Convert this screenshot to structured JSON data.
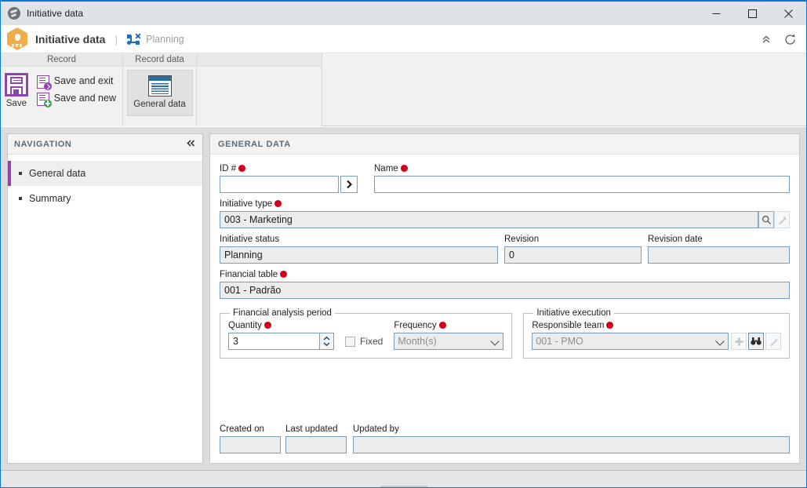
{
  "window": {
    "title": "Initiative data",
    "icon": "globe-icon",
    "minimize_label": "Minimize",
    "maximize_label": "Maximize",
    "close_label": "Close"
  },
  "header": {
    "app_title": "Initiative data",
    "separator": "|",
    "context_label": "Planning",
    "context_icon": "workflow-icon",
    "collapse_icon": "chevron-double-up-icon",
    "refresh_icon": "refresh-icon",
    "accent_hex": "#f0ad4e"
  },
  "ribbon": {
    "groups": [
      {
        "title": "Record"
      },
      {
        "title": "Record data"
      },
      {
        "title": ""
      }
    ],
    "save_label": "Save",
    "save_and_exit_label": "Save and exit",
    "save_and_new_label": "Save and new",
    "general_data_label": "General data",
    "save_icon": "floppy-disk-icon",
    "save_exit_icon": "document-arrow-icon",
    "save_new_icon": "document-plus-icon",
    "general_data_icon": "document-lines-icon",
    "accent_hex": "#8e44ad"
  },
  "navigation": {
    "title": "NAVIGATION",
    "collapse_icon": "chevron-double-left-icon",
    "items": [
      {
        "label": "General data",
        "active": true
      },
      {
        "label": "Summary",
        "active": false
      }
    ],
    "active_marker_hex": "#8e44ad"
  },
  "panel": {
    "title": "GENERAL DATA"
  },
  "form": {
    "required_marker": "required-asterisk-icon",
    "id": {
      "label": "ID #",
      "required": true,
      "value": "",
      "go_icon": "chevron-right-icon"
    },
    "name": {
      "label": "Name",
      "required": true,
      "value": ""
    },
    "initiative_type": {
      "label": "Initiative type",
      "required": true,
      "value": "003 - Marketing",
      "search_icon": "magnifier-icon",
      "clear_icon": "eraser-icon"
    },
    "initiative_status": {
      "label": "Initiative status",
      "required": false,
      "value": "Planning"
    },
    "revision": {
      "label": "Revision",
      "required": false,
      "value": "0"
    },
    "revision_date": {
      "label": "Revision date",
      "required": false,
      "value": ""
    },
    "financial_table": {
      "label": "Financial table",
      "required": true,
      "value": "001 - Padrão"
    },
    "financial_analysis_period": {
      "legend": "Financial analysis period",
      "quantity": {
        "label": "Quantity",
        "required": true,
        "value": "3",
        "spinner_icon": "spinner-up-down-icon"
      },
      "fixed": {
        "label": "Fixed",
        "checked": false
      },
      "frequency": {
        "label": "Frequency",
        "required": true,
        "value": "Month(s)",
        "options": [
          "Month(s)"
        ],
        "dropdown_icon": "chevron-down-icon"
      }
    },
    "initiative_execution": {
      "legend": "Initiative execution",
      "responsible_team": {
        "label": "Responsible team",
        "required": true,
        "value": "001 - PMO",
        "options": [
          "001 - PMO"
        ],
        "dropdown_icon": "chevron-down-icon",
        "add_icon": "plus-icon",
        "find_icon": "binoculars-icon",
        "clear_icon": "eraser-icon"
      }
    },
    "created_on": {
      "label": "Created on",
      "value": ""
    },
    "last_updated": {
      "label": "Last updated",
      "value": ""
    },
    "updated_by": {
      "label": "Updated by",
      "value": ""
    }
  }
}
